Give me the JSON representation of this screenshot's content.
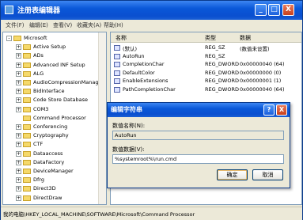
{
  "window": {
    "title": "注册表编辑器"
  },
  "menu": [
    "文件(F)",
    "编辑(E)",
    "查看(V)",
    "收藏夹(A)",
    "帮助(H)"
  ],
  "tree": {
    "items": [
      {
        "label": "Microsoft",
        "exp": "-"
      },
      {
        "label": "Active Setup",
        "exp": "+"
      },
      {
        "label": "ADs",
        "exp": "+"
      },
      {
        "label": "Advanced INF Setup",
        "exp": "+"
      },
      {
        "label": "ALG",
        "exp": "+"
      },
      {
        "label": "AudioCompressionManag",
        "exp": "+"
      },
      {
        "label": "BidInterface",
        "exp": "+"
      },
      {
        "label": "Code Store Database",
        "exp": "+"
      },
      {
        "label": "COM3",
        "exp": "+"
      },
      {
        "label": "Command Processor",
        "exp": ""
      },
      {
        "label": "Conferencing",
        "exp": "+"
      },
      {
        "label": "Cryptography",
        "exp": "+"
      },
      {
        "label": "CTF",
        "exp": "+"
      },
      {
        "label": "Dataaccess",
        "exp": "+"
      },
      {
        "label": "DataFactory",
        "exp": "+"
      },
      {
        "label": "DeviceManager",
        "exp": "+"
      },
      {
        "label": "Dfrg",
        "exp": "+"
      },
      {
        "label": "Direct3D",
        "exp": "+"
      },
      {
        "label": "DirectDraw",
        "exp": "+"
      }
    ]
  },
  "list": {
    "headers": {
      "name": "名称",
      "type": "类型",
      "data": "数据"
    },
    "rows": [
      {
        "name": "(默认)",
        "type": "REG_SZ",
        "data": "(数值未设置)",
        "icon": "ab"
      },
      {
        "name": "AutoRun",
        "type": "REG_SZ",
        "data": "",
        "icon": "ab"
      },
      {
        "name": "CompletionChar",
        "type": "REG_DWORD",
        "data": "0x00000040 (64)",
        "icon": "01"
      },
      {
        "name": "DefaultColor",
        "type": "REG_DWORD",
        "data": "0x00000000 (0)",
        "icon": "01"
      },
      {
        "name": "EnableExtensions",
        "type": "REG_DWORD",
        "data": "0x00000001 (1)",
        "icon": "01"
      },
      {
        "name": "PathCompletionChar",
        "type": "REG_DWORD",
        "data": "0x00000040 (64)",
        "icon": "01"
      }
    ]
  },
  "status": "我的电脑\\HKEY_LOCAL_MACHINE\\SOFTWARE\\Microsoft\\Command Processor",
  "dialog": {
    "title": "编辑字符串",
    "help_btn": "?",
    "close_btn": "X",
    "name_label": "数值名称(N):",
    "name_value": "AutoRun",
    "data_label": "数值数据(V):",
    "data_value": "%systemroot%\\run.cmd",
    "ok": "确定",
    "cancel": "取消"
  },
  "titlebar_buttons": {
    "min": "_",
    "max": "□",
    "close": "X"
  }
}
